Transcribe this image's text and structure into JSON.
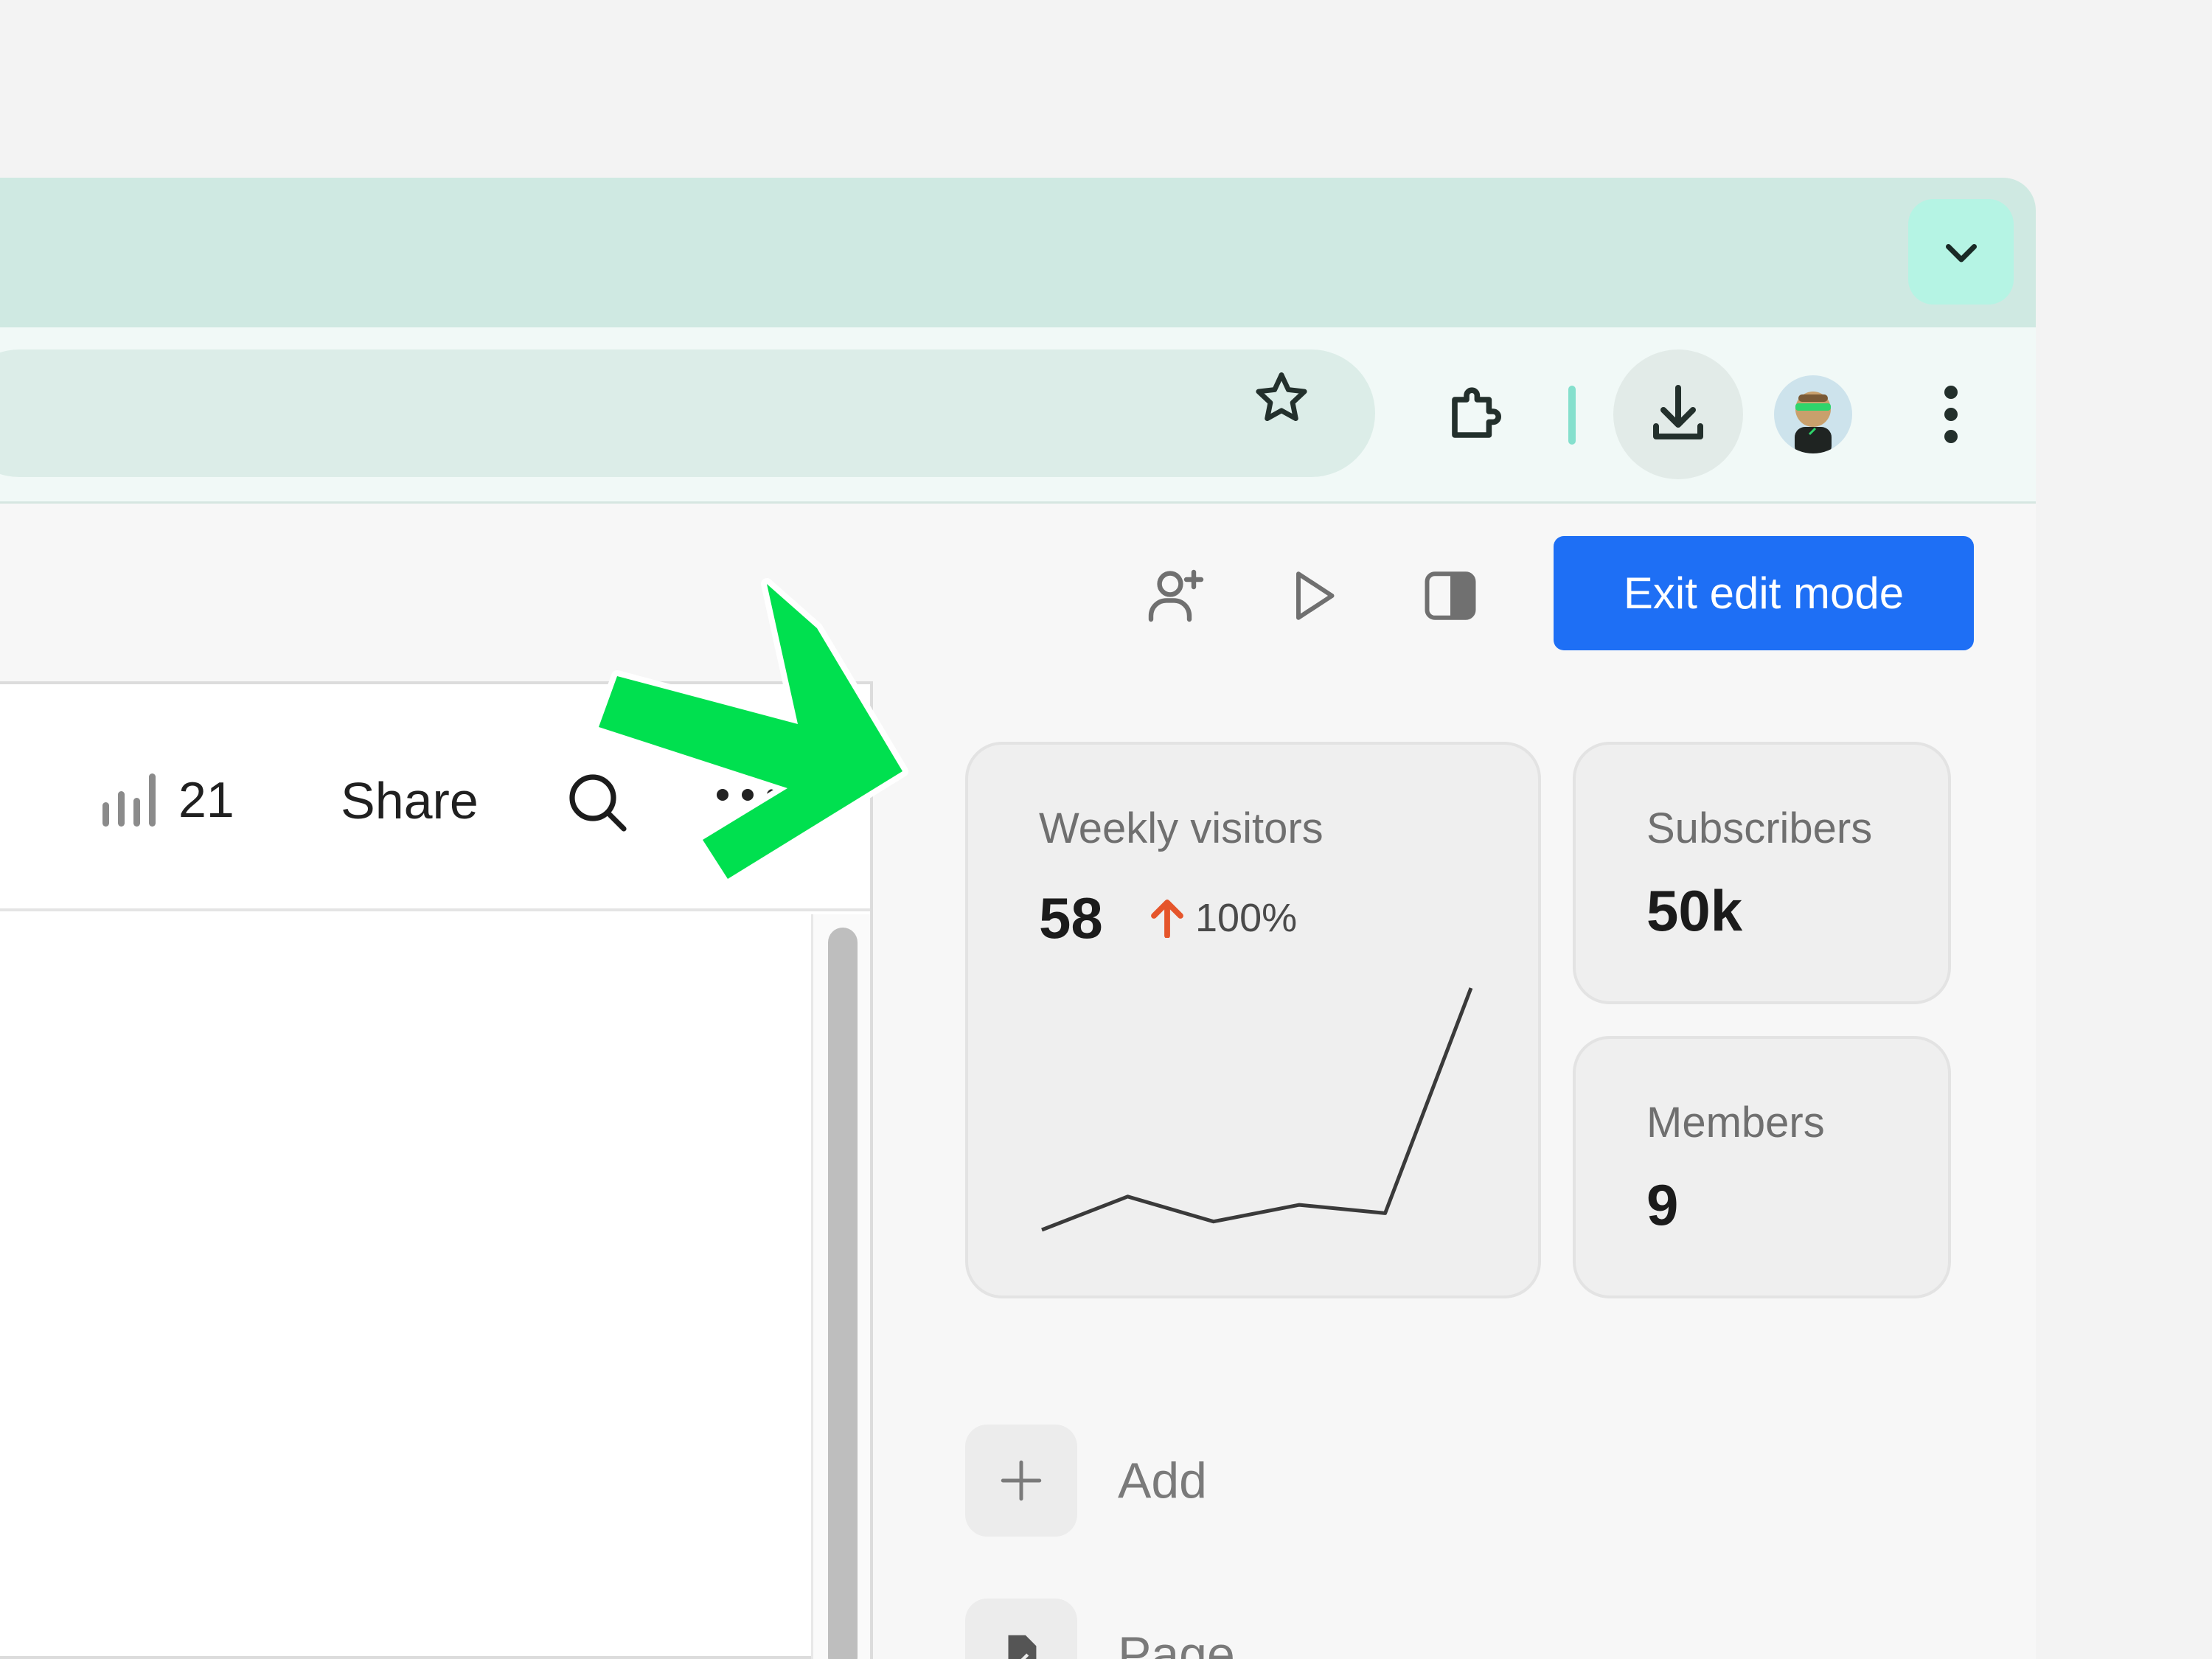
{
  "browser": {
    "tab_search_icon": "chevron-down-icon",
    "toolbar_icons": [
      "star-icon",
      "puzzle-extension-icon",
      "download-icon",
      "profile-avatar",
      "kebab-menu-icon"
    ],
    "accent_color": "#cfe9e2"
  },
  "pagebar": {
    "icons": [
      "add-person-icon",
      "play-icon",
      "sidebar-toggle-icon"
    ],
    "exit_label": "Exit edit mode",
    "exit_color": "#1e6ff5"
  },
  "doc": {
    "views_count": "21",
    "share_label": "Share"
  },
  "stats": {
    "weekly": {
      "label": "Weekly visitors",
      "value": "58",
      "delta": "100%",
      "delta_color": "#e5552b",
      "trend": [
        0,
        4,
        1,
        3,
        2,
        29
      ]
    },
    "subscribers": {
      "label": "Subscribers",
      "value": "50k"
    },
    "members": {
      "label": "Members",
      "value": "9"
    }
  },
  "actions": {
    "add_label": "Add",
    "page_label": "Page"
  },
  "annotation_arrow_color": "#00e04f"
}
